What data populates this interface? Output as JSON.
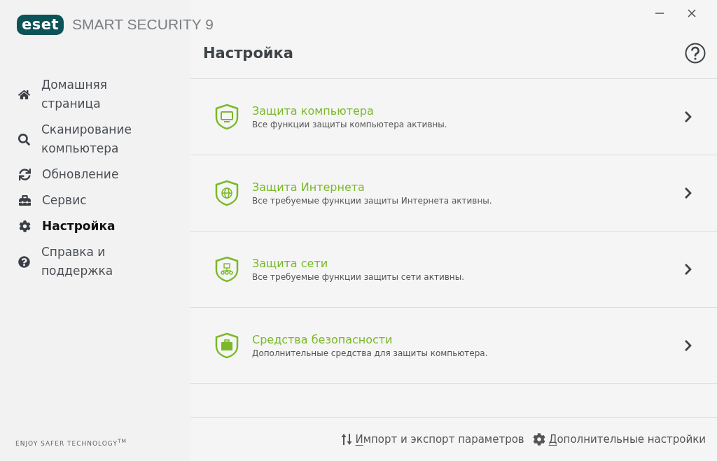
{
  "brand": {
    "logo": "eset",
    "product": "SMART SECURITY 9",
    "tagline": "ENJOY SAFER TECHNOLOGY",
    "tagline_mark": "TM"
  },
  "sidebar": {
    "items": [
      {
        "label": "Домашняя страница",
        "kind": "home",
        "selected": false
      },
      {
        "label": "Сканирование компьютера",
        "kind": "search",
        "selected": false
      },
      {
        "label": "Обновление",
        "kind": "update",
        "selected": false
      },
      {
        "label": "Сервис",
        "kind": "tools",
        "selected": false
      },
      {
        "label": "Настройка",
        "kind": "settings",
        "selected": true
      },
      {
        "label": "Справка и поддержка",
        "kind": "help",
        "selected": false
      }
    ]
  },
  "page": {
    "title": "Настройка",
    "sections": [
      {
        "kind": "computer",
        "title": "Защита компьютера",
        "description": "Все функции защиты компьютера активны."
      },
      {
        "kind": "internet",
        "title": "Защита Интернета",
        "description": "Все требуемые функции защиты Интернета активны."
      },
      {
        "kind": "network",
        "title": "Защита сети",
        "description": "Все требуемые функции защиты сети активны."
      },
      {
        "kind": "tools",
        "title": "Средства безопасности",
        "description": "Дополнительные средства для защиты компьютера."
      }
    ]
  },
  "footer": {
    "actions": [
      {
        "kind": "import",
        "label": "Импорт и экспорт параметров",
        "mnemonic_underlined": true
      },
      {
        "kind": "advanced",
        "label": "Дополнительные настройки",
        "mnemonic_underlined": true
      }
    ]
  }
}
